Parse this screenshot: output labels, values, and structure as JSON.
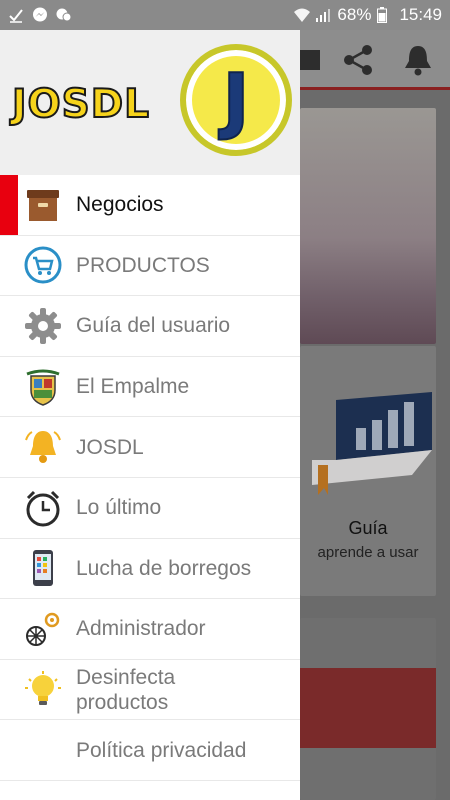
{
  "status_bar": {
    "battery": "68%",
    "time": "15:49"
  },
  "drawer": {
    "logo_text": "JOSDL",
    "logo_badge_letter": "J",
    "items": [
      {
        "label": "Negocios",
        "icon": "archive-box-icon",
        "active": true
      },
      {
        "label": "PRODUCTOS",
        "icon": "shopping-cart-icon",
        "active": false
      },
      {
        "label": "Guía del usuario",
        "icon": "gear-icon",
        "active": false
      },
      {
        "label": "El Empalme",
        "icon": "coat-of-arms-icon",
        "active": false
      },
      {
        "label": "JOSDL",
        "icon": "bell-icon",
        "active": false
      },
      {
        "label": "Lo último",
        "icon": "alarm-clock-icon",
        "active": false
      },
      {
        "label": "Lucha de borregos",
        "icon": "smartphone-apps-icon",
        "active": false
      },
      {
        "label": "Administrador",
        "icon": "admin-gears-icon",
        "active": false
      },
      {
        "label": "Desinfecta\nproductos",
        "icon": "lightbulb-icon",
        "active": false
      },
      {
        "label": "Política privacidad",
        "icon": "",
        "active": false
      }
    ]
  },
  "background": {
    "card_guide": {
      "title": "Guía",
      "subtitle": "aprende a usar"
    },
    "toolbar_icons": [
      "window-icon",
      "share-icon",
      "bell-icon"
    ]
  },
  "colors": {
    "active_marker": "#e8000f",
    "logo_yellow": "#f6d31b"
  }
}
